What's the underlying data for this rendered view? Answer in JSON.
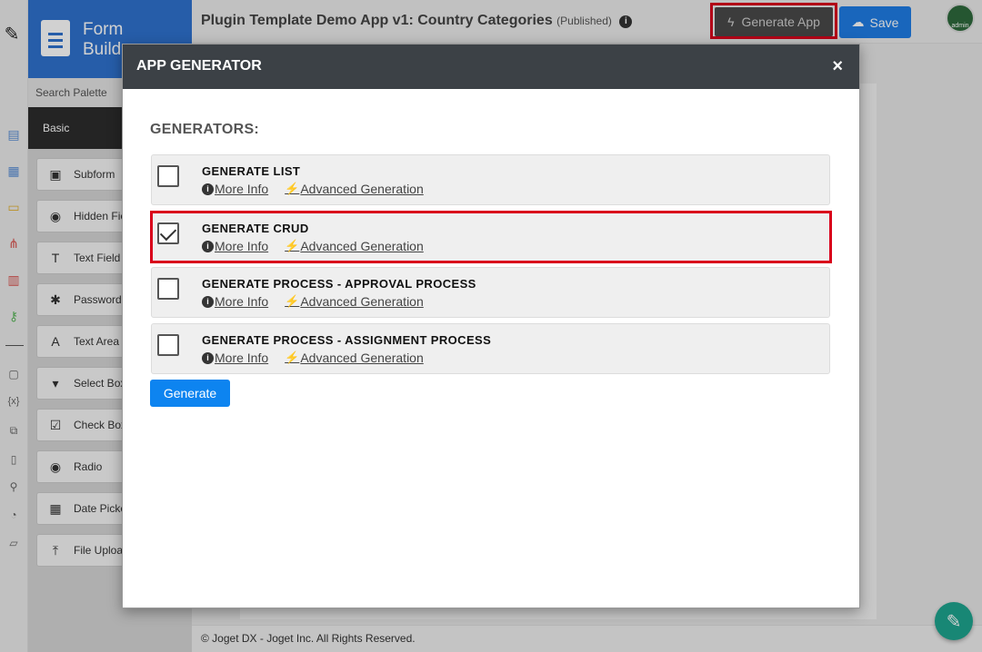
{
  "sidebar": {
    "brand_title": "Form Builder",
    "search_placeholder": "Search Palette",
    "basic_tab": "Basic",
    "items": [
      {
        "label": "Subform",
        "icon": "subform-icon",
        "glyph": "▣"
      },
      {
        "label": "Hidden Field",
        "icon": "eye-slash-icon",
        "glyph": "◉"
      },
      {
        "label": "Text Field",
        "icon": "text-field-icon",
        "glyph": "T"
      },
      {
        "label": "Password",
        "icon": "asterisk-icon",
        "glyph": "✱"
      },
      {
        "label": "Text Area",
        "icon": "text-area-icon",
        "glyph": "A"
      },
      {
        "label": "Select Box",
        "icon": "select-box-icon",
        "glyph": "▾"
      },
      {
        "label": "Check Box",
        "icon": "check-box-icon",
        "glyph": "☑"
      },
      {
        "label": "Radio",
        "icon": "radio-icon",
        "glyph": "◉"
      },
      {
        "label": "Date Picker",
        "icon": "calendar-icon",
        "glyph": "▦"
      },
      {
        "label": "File Upload",
        "icon": "upload-icon",
        "glyph": "⤒"
      }
    ]
  },
  "header": {
    "title": "Plugin Template Demo App v1: Country Categories",
    "status": "(Published)",
    "generate_app_label": "Generate App",
    "save_label": "Save",
    "avatar_text": "admin"
  },
  "modal": {
    "title": "APP GENERATOR",
    "close_glyph": "×",
    "section_label": "GENERATORS:",
    "more_info_label": "More Info",
    "advanced_label": "Advanced Generation",
    "generators": [
      {
        "name": "GENERATE LIST",
        "checked": false
      },
      {
        "name": "GENERATE CRUD",
        "checked": true
      },
      {
        "name": "GENERATE PROCESS - APPROVAL PROCESS",
        "checked": false
      },
      {
        "name": "GENERATE PROCESS - ASSIGNMENT PROCESS",
        "checked": false
      }
    ],
    "generate_button": "Generate"
  },
  "footer": {
    "text": "© Joget DX - Joget Inc. All Rights Reserved."
  },
  "colors": {
    "brand_blue": "#2f72cf",
    "highlight_red": "#d9001b",
    "modal_header": "#3c4146",
    "generate_button": "#0d84f0",
    "fab_teal": "#1ea58f"
  }
}
